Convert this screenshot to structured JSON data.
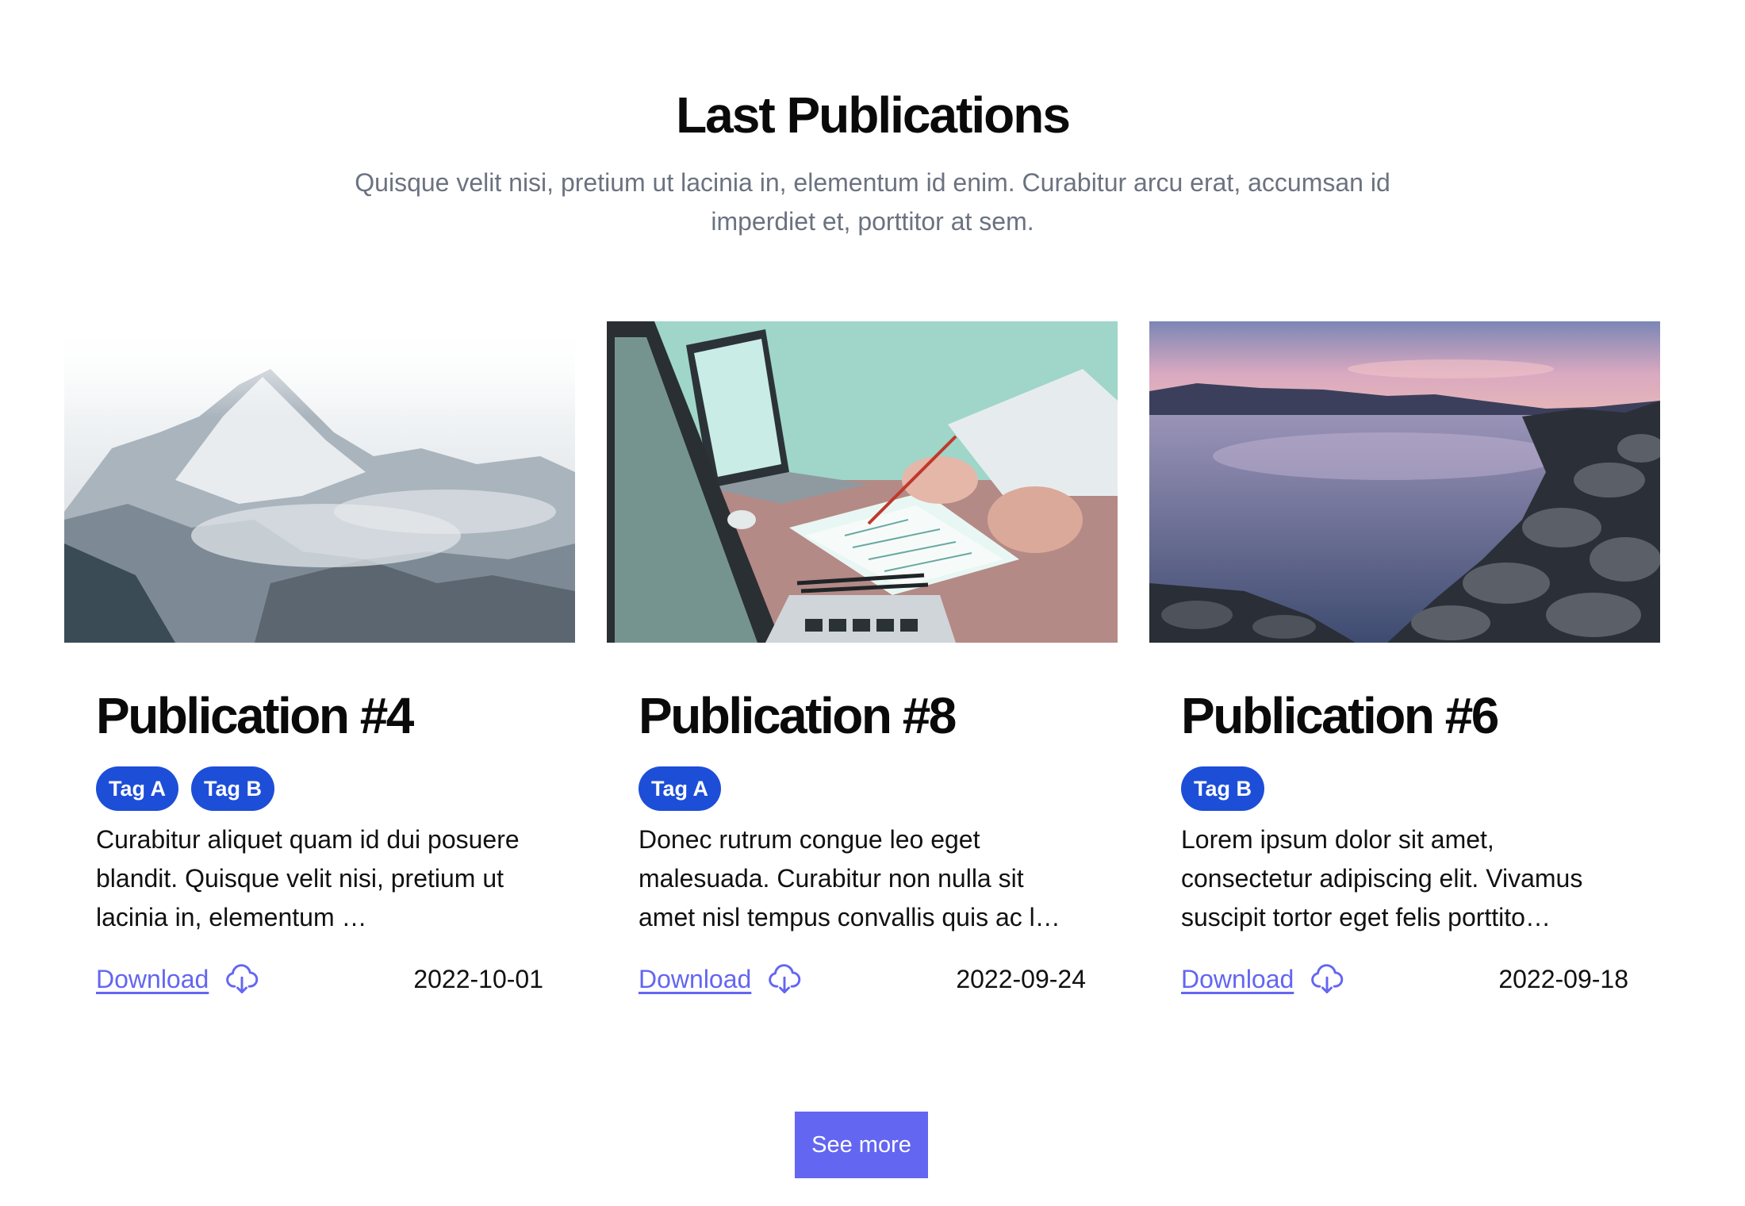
{
  "header": {
    "title": "Last Publications",
    "subtitle": "Quisque velit nisi, pretium ut lacinia in, elementum id enim. Curabitur arcu erat, accumsan id imperdiet et, porttitor at sem."
  },
  "cards": [
    {
      "image_icon": "mountain-clouds-photo",
      "title": "Publication #4",
      "tags": [
        "Tag A",
        "Tag B"
      ],
      "description": "Curabitur aliquet quam id dui posuere blandit. Quisque velit nisi, pretium ut lacinia in, elementum …",
      "download_label": "Download",
      "date": "2022-10-01"
    },
    {
      "image_icon": "laptop-meeting-photo",
      "title": "Publication #8",
      "tags": [
        "Tag A"
      ],
      "description": "Donec rutrum congue leo eget malesuada. Curabitur non nulla sit amet nisl tempus convallis quis ac l…",
      "download_label": "Download",
      "date": "2022-09-24"
    },
    {
      "image_icon": "rocky-coast-sunset-photo",
      "title": "Publication #6",
      "tags": [
        "Tag B"
      ],
      "description": "Lorem ipsum dolor sit amet, consectetur adipiscing elit. Vivamus suscipit tortor eget felis porttito…",
      "download_label": "Download",
      "date": "2022-09-18"
    }
  ],
  "see_more_label": "See more",
  "colors": {
    "accent": "#6366f1",
    "tag_bg": "#1d4ed8",
    "subtitle": "#6b7280"
  }
}
